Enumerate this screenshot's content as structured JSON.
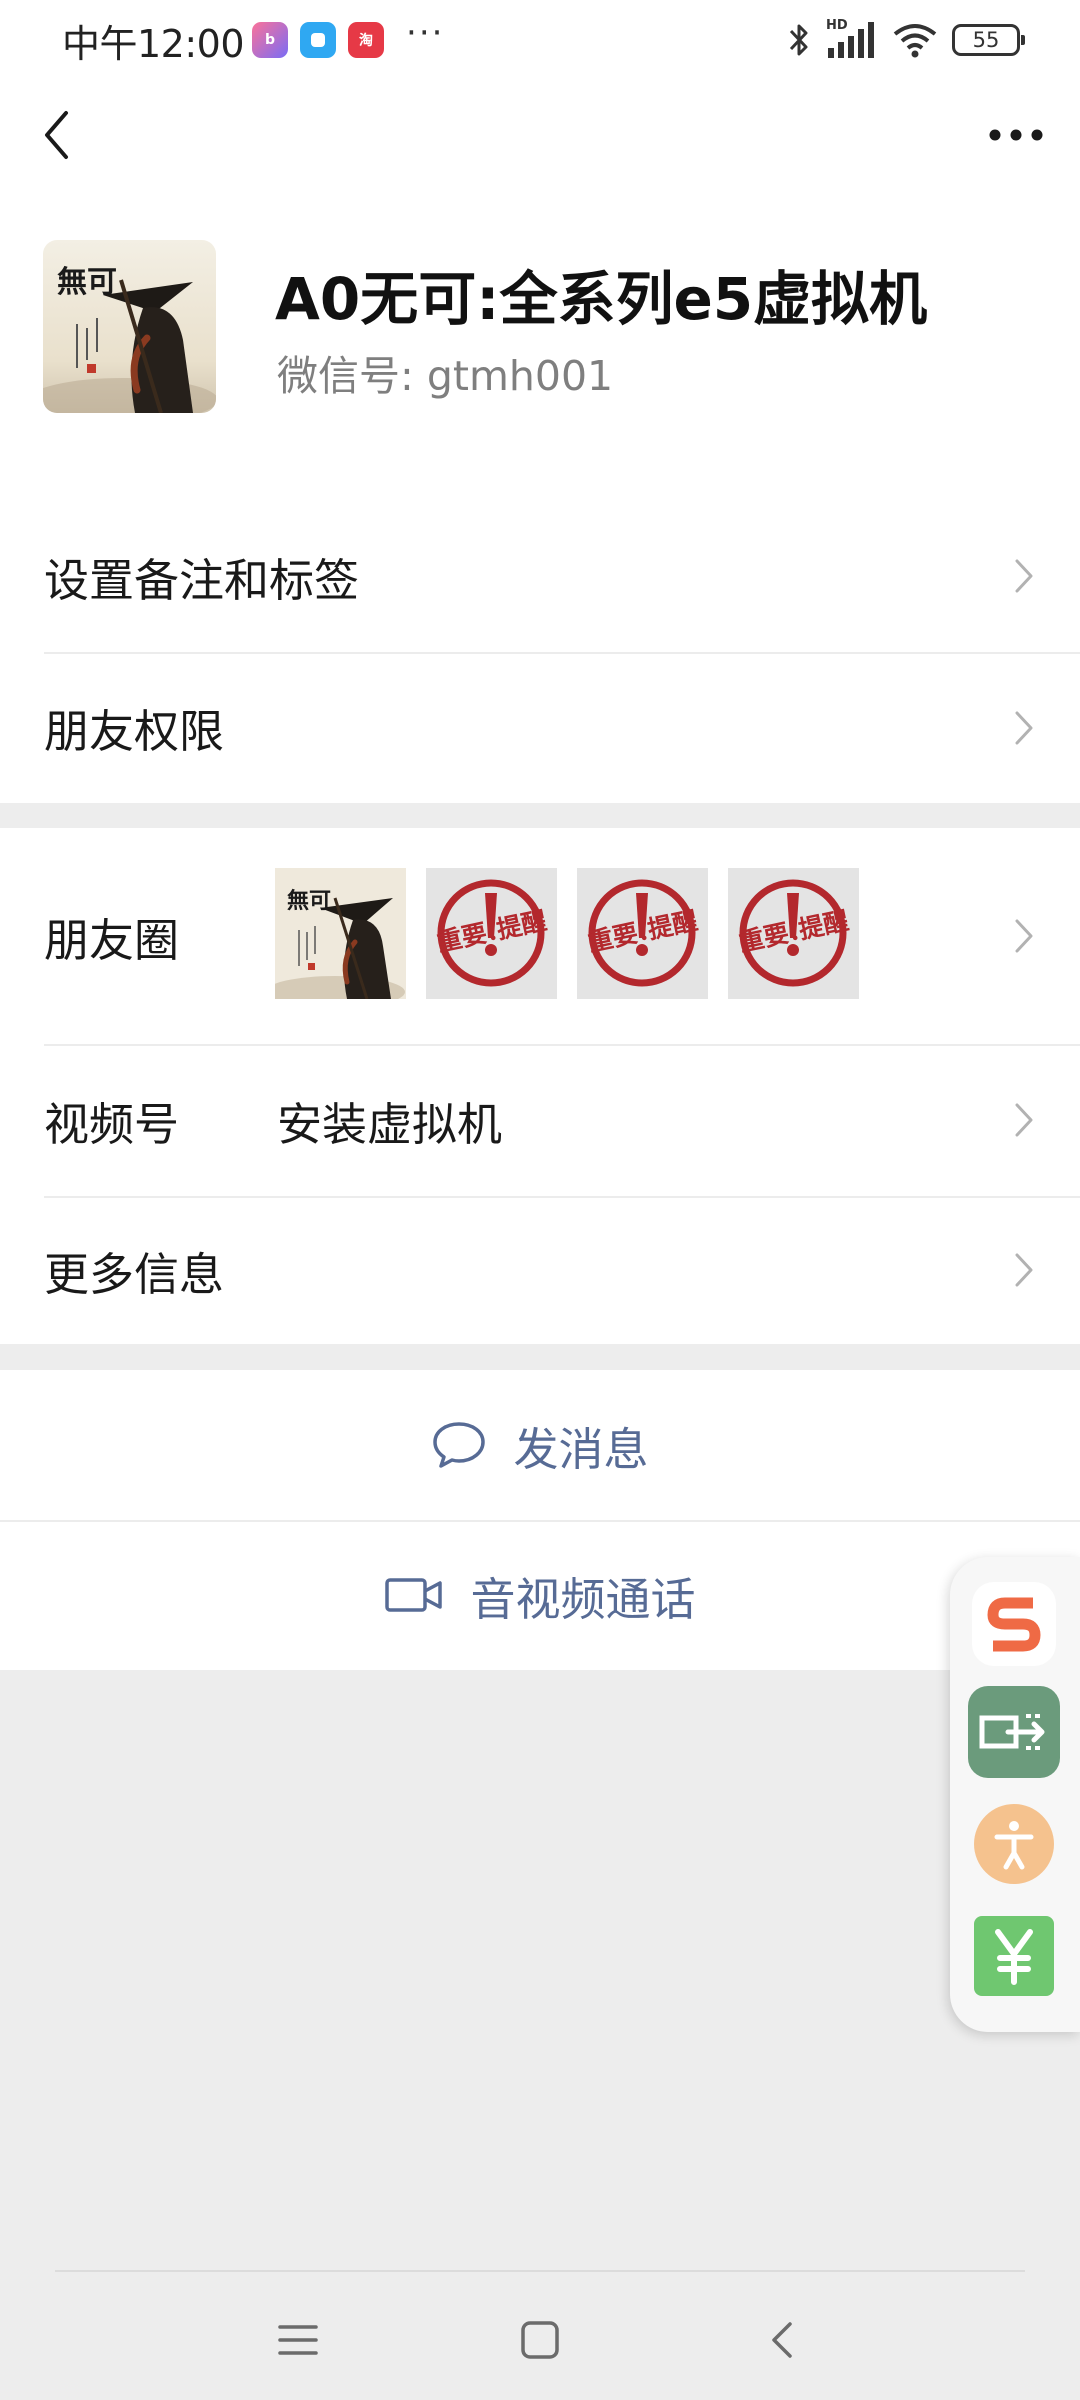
{
  "status_bar": {
    "time": "中午12:00",
    "overflow": "···",
    "battery": "55",
    "network_badge": "HD",
    "app_icons": [
      "bilibili-app-icon",
      "blue-chat-app-icon",
      "taobao-app-icon"
    ],
    "status_icons": [
      "bluetooth-icon",
      "signal-icon",
      "wifi-icon",
      "battery-icon"
    ]
  },
  "nav": {
    "back_icon": "chevron-left-icon",
    "more_icon": "more-dots-icon"
  },
  "profile": {
    "name": "A0无可:全系列e5虚拟机",
    "wechat_id": "微信号:  gtmh001"
  },
  "settings": {
    "remark_tags": "设置备注和标签",
    "permissions": "朋友权限"
  },
  "info": {
    "moments_label": "朋友圈",
    "moments_thumbs": [
      {
        "type": "avatar-art"
      },
      {
        "type": "notice",
        "text": "重要!提醒"
      },
      {
        "type": "notice",
        "text": "重要!提醒"
      },
      {
        "type": "notice",
        "text": "重要!提醒"
      }
    ],
    "channels_label": "视频号",
    "channels_value": "安装虚拟机",
    "more_info": "更多信息"
  },
  "actions": {
    "send_message": "发消息",
    "av_call": "音视频通话"
  },
  "floating_toolbar": [
    {
      "icon": "sogou-s-icon",
      "color": "#ef6a45"
    },
    {
      "icon": "screen-share-icon",
      "color": "#6b9b7c"
    },
    {
      "icon": "accessibility-icon",
      "color": "#f5c28e"
    },
    {
      "icon": "yuan-payment-icon",
      "color": "#6fc770"
    }
  ],
  "system_nav": [
    "menu-icon",
    "home-icon",
    "back-icon"
  ],
  "colors": {
    "link_blue": "#576b95",
    "background": "#ededed",
    "divider": "#ececec",
    "notice_red": "#b3282d"
  }
}
